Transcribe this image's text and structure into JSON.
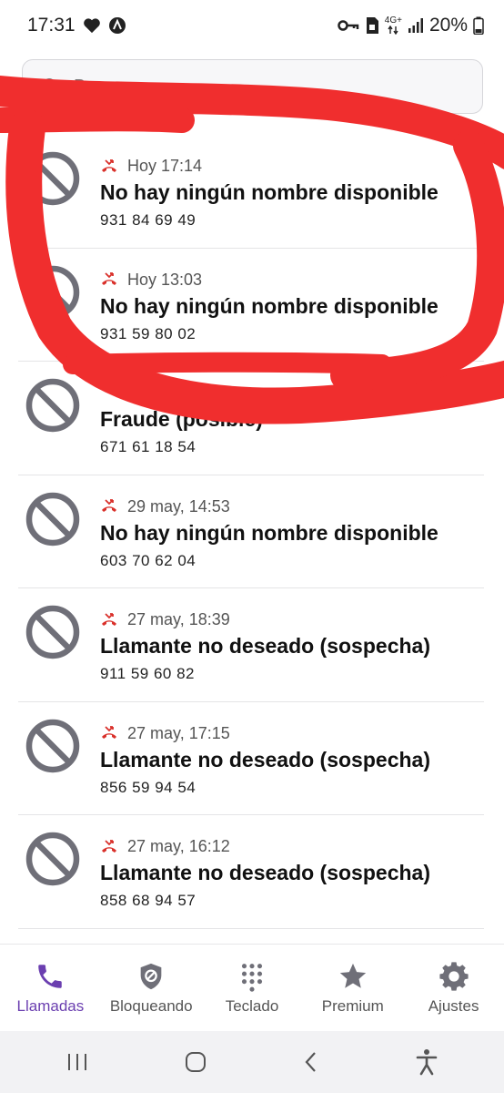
{
  "status_bar": {
    "time": "17:31",
    "network": "4G+",
    "battery": "20%",
    "icons": [
      "heart-icon",
      "app-badge-icon",
      "vpn-key-icon",
      "sim-icon",
      "network-arrows-icon",
      "signal-icon",
      "battery-icon"
    ]
  },
  "search": {
    "placeholder": "Busc"
  },
  "calls": [
    {
      "time": "Hoy 17:14",
      "name": "No hay ningún nombre disponible",
      "number": "931 84 69 49"
    },
    {
      "time": "Hoy 13:03",
      "name": "No hay ningún nombre disponible",
      "number": "931 59 80 02"
    },
    {
      "time": "",
      "name": "Fraude (posible)",
      "number": "671 61 18 54"
    },
    {
      "time": "29 may, 14:53",
      "name": "No hay ningún nombre disponible",
      "number": "603 70 62 04"
    },
    {
      "time": "27 may, 18:39",
      "name": "Llamante no deseado (sospecha)",
      "number": "911 59 60 82"
    },
    {
      "time": "27 may, 17:15",
      "name": "Llamante no deseado (sospecha)",
      "number": "856 59 94 54"
    },
    {
      "time": "27 may, 16:12",
      "name": "Llamante no deseado (sospecha)",
      "number": "858 68 94 57"
    }
  ],
  "bottom_nav": [
    {
      "label": "Llamadas",
      "icon": "phone-icon",
      "active": true
    },
    {
      "label": "Bloqueando",
      "icon": "shield-block-icon",
      "active": false
    },
    {
      "label": "Teclado",
      "icon": "dialpad-icon",
      "active": false
    },
    {
      "label": "Premium",
      "icon": "star-icon",
      "active": false
    },
    {
      "label": "Ajustes",
      "icon": "settings-gear-icon",
      "active": false
    }
  ],
  "colors": {
    "accent": "#6b3fb0",
    "missed_call": "#d9302a",
    "block_icon": "#6f6f78",
    "annotation": "#f02e2e"
  }
}
